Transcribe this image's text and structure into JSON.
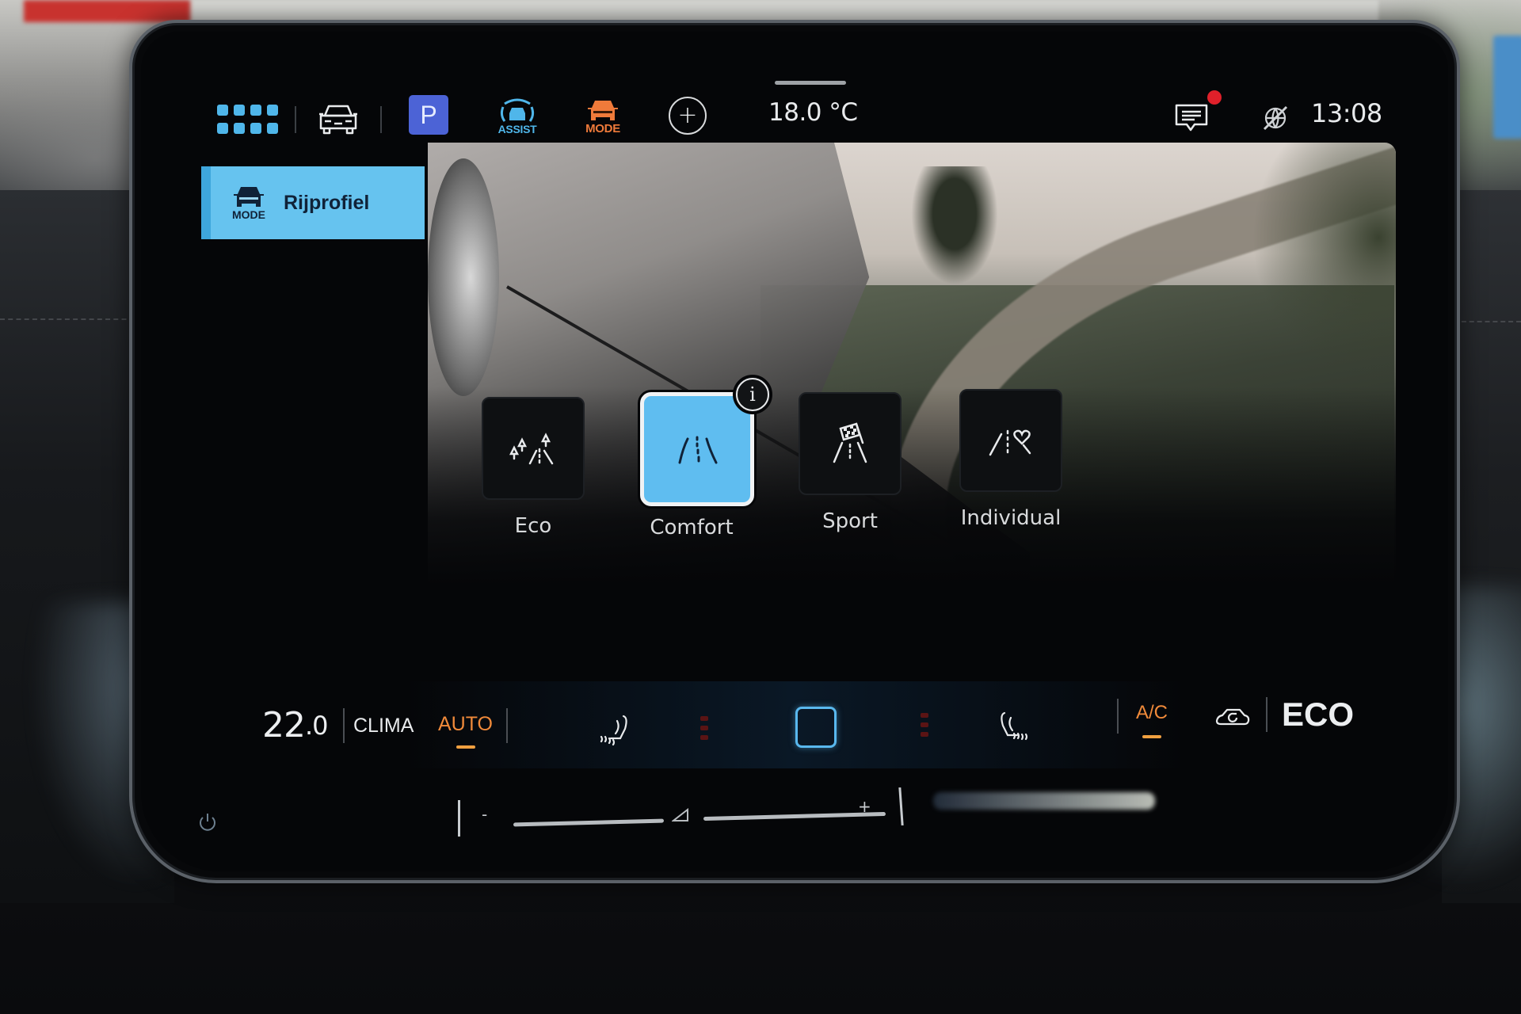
{
  "status_bar": {
    "icons": {
      "apps": "apps-grid-icon",
      "vehicle": "car-icon",
      "park": "parking-icon",
      "assist": "driver-assist-icon",
      "mode": "drive-mode-icon",
      "add": "plus-icon",
      "messages": "message-icon",
      "connectivity": "no-connection-icon"
    },
    "park_label": "P",
    "assist_label": "ASSIST",
    "mode_label": "MODE",
    "add_label": "+",
    "outside_temp": "18.0 °C",
    "notification_badge": true,
    "clock": "13:08"
  },
  "sidebar": {
    "active_item": {
      "icon_label": "MODE",
      "title": "Rijprofiel"
    }
  },
  "drive_modes": {
    "selected": "Comfort",
    "items": [
      {
        "label": "Eco",
        "icon": "eco-road-trees-icon",
        "active": false
      },
      {
        "label": "Comfort",
        "icon": "comfort-road-icon",
        "active": true
      },
      {
        "label": "Sport",
        "icon": "sport-checkered-flag-icon",
        "active": false
      },
      {
        "label": "Individual",
        "icon": "individual-heart-road-icon",
        "active": false
      }
    ],
    "info_label": "i"
  },
  "climate": {
    "set_temp_main": "22",
    "set_temp_decimal": ".0",
    "clima_label": "CLIMA",
    "auto_label": "AUTO",
    "auto_active": true,
    "ac_label": "A/C",
    "ac_active": true,
    "eco_label": "ECO",
    "seat_heat_left_level": 0,
    "seat_heat_right_level": 0
  },
  "touch_slider": {
    "minus_label": "-",
    "plus_label": "+"
  },
  "colors": {
    "accent_blue": "#5fbdf0",
    "park_blue": "#4c63d6",
    "mode_orange": "#ef7a3a",
    "active_orange": "#f08a3a",
    "badge_red": "#e0202a"
  }
}
